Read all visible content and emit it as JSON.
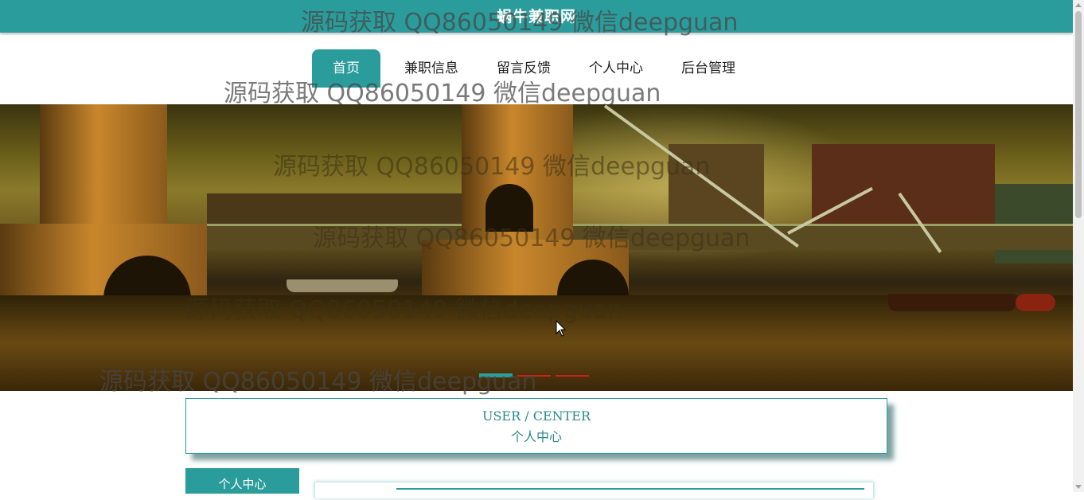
{
  "site": {
    "title": "蜗牛兼职网"
  },
  "nav": {
    "items": [
      {
        "label": "首页"
      },
      {
        "label": "兼职信息"
      },
      {
        "label": "留言反馈"
      },
      {
        "label": "个人中心"
      },
      {
        "label": "后台管理"
      }
    ],
    "active_index": 0
  },
  "watermark": {
    "text": "源码获取 QQ86050149 微信deepguan"
  },
  "carousel": {
    "slide_count": 3,
    "active_index": 0
  },
  "section_header": {
    "title_en": "USER / CENTER",
    "title_zh": "个人中心"
  },
  "sidebar": {
    "tab_label": "个人中心"
  },
  "colors": {
    "primary": "#2b9c9c",
    "indicator": "#c8241c"
  }
}
